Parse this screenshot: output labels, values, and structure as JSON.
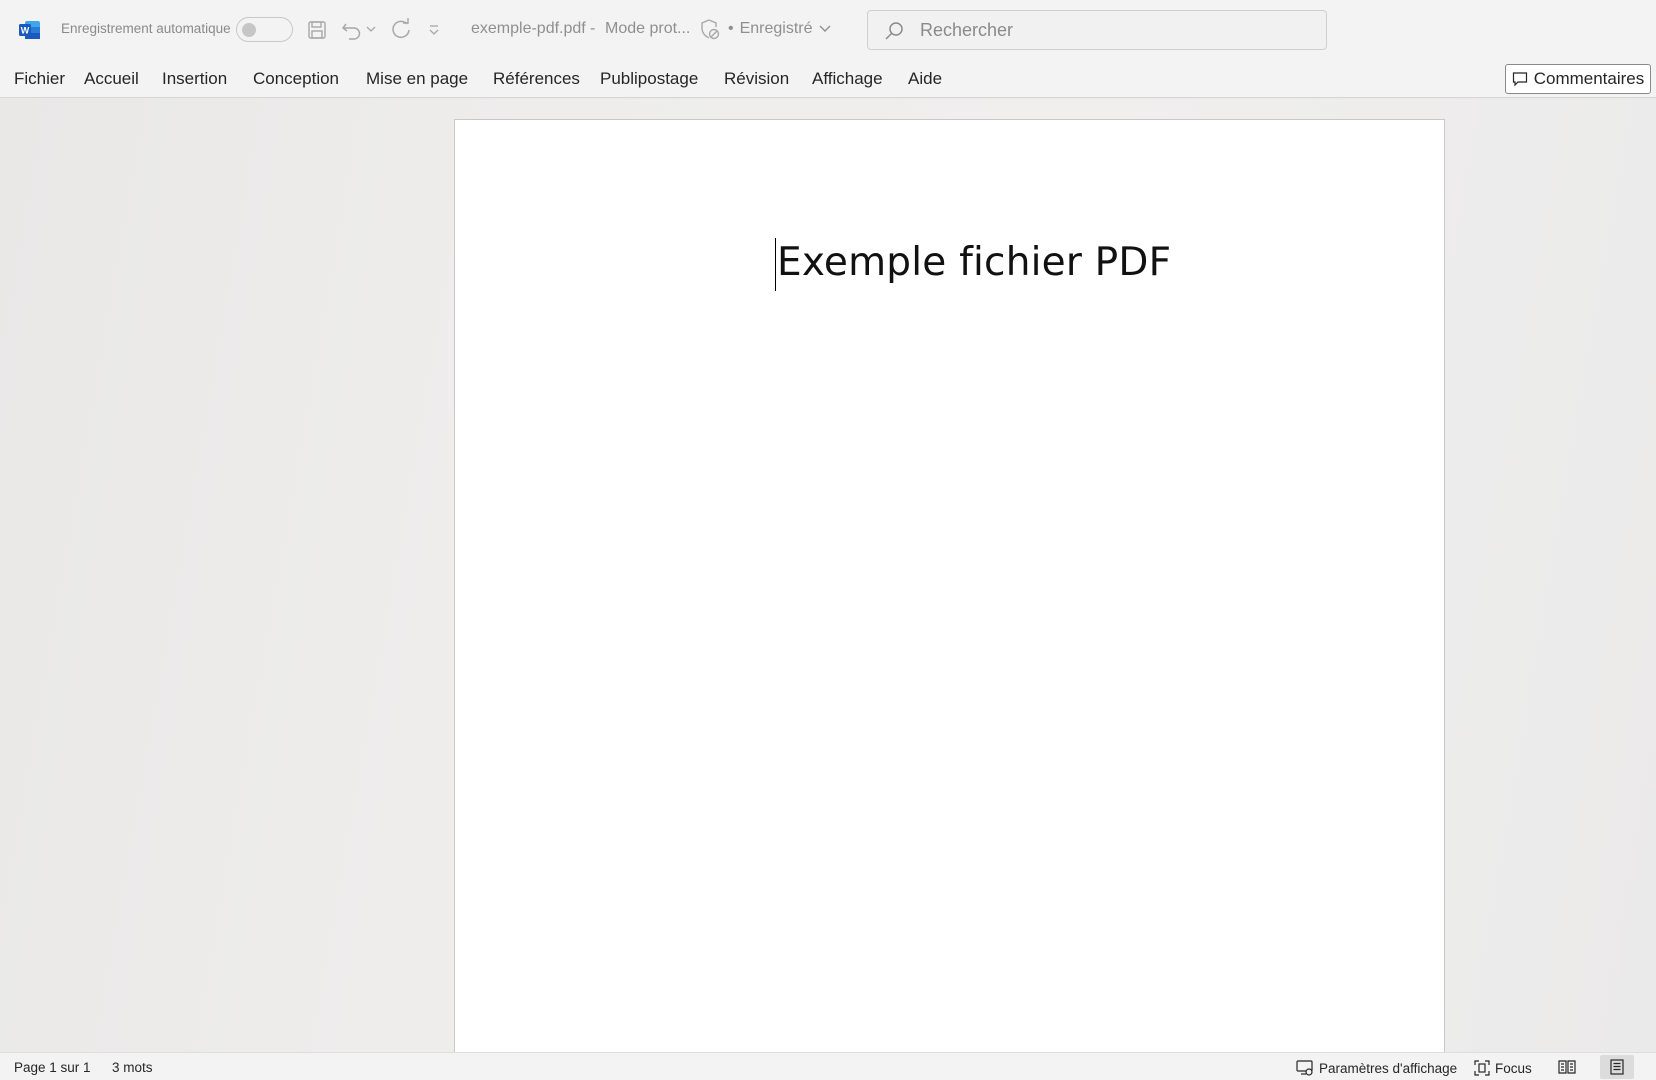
{
  "titlebar": {
    "app_icon": "word-icon",
    "autosave_label": "Enregistrement automatique",
    "autosave_on": false,
    "save_icon": "save-icon",
    "undo_icon": "undo-icon",
    "redo_icon": "redo-icon",
    "customize_icon": "customize-quick-access-icon",
    "filename": "exemple-pdf.pdf",
    "separator": "-",
    "mode": "Mode prot...",
    "status_dot": "•",
    "saved_status": "Enregistré",
    "search_placeholder": "Rechercher"
  },
  "menu": {
    "tabs": [
      {
        "label": "Fichier"
      },
      {
        "label": "Accueil"
      },
      {
        "label": "Insertion"
      },
      {
        "label": "Conception"
      },
      {
        "label": "Mise en page"
      },
      {
        "label": "Références"
      },
      {
        "label": "Publipostage"
      },
      {
        "label": "Révision"
      },
      {
        "label": "Affichage"
      },
      {
        "label": "Aide"
      }
    ],
    "comments_label": "Commentaires"
  },
  "document": {
    "heading": "Exemple fichier PDF"
  },
  "statusbar": {
    "page_info": "Page 1 sur 1",
    "word_count": "3 mots",
    "display_settings": "Paramètres d'affichage",
    "focus": "Focus",
    "active_view": "print-layout"
  },
  "colors": {
    "word_blue": "#185abd",
    "chrome_bg": "#f3f3f3",
    "canvas_bg": "#eae9e8"
  }
}
